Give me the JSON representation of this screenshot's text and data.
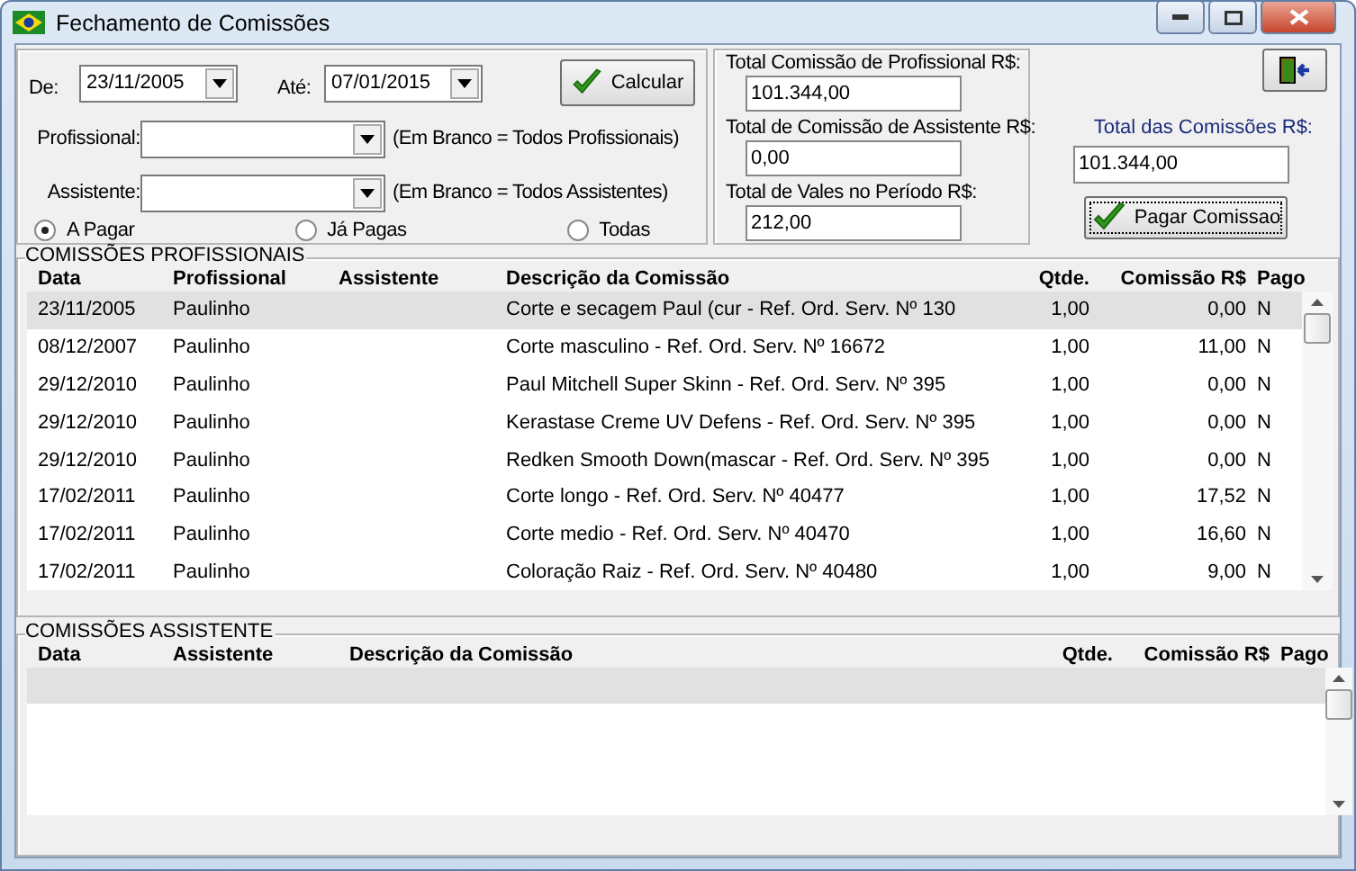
{
  "window": {
    "title": "Fechamento de Comissões"
  },
  "filters": {
    "from_label": "De:",
    "from_date": "23/11/2005",
    "to_label": "Até:",
    "to_date": "07/01/2015",
    "calculate_button": "Calcular",
    "professional_label": "Profissional:",
    "professional_hint": "(Em Branco = Todos Profissionais)",
    "assistant_label": "Assistente:",
    "assistant_hint": "(Em Branco = Todos Assistentes)",
    "status_options": [
      {
        "label": "A Pagar",
        "selected": true
      },
      {
        "label": "Já Pagas",
        "selected": false
      },
      {
        "label": "Todas",
        "selected": false
      }
    ]
  },
  "totals": [
    {
      "label": "Total Comissão de Profissional R$:",
      "value": "101.344,00"
    },
    {
      "label": "Total de Comissão de Assistente R$:",
      "value": "0,00"
    },
    {
      "label": "Total de Vales no Período R$:",
      "value": "212,00"
    }
  ],
  "grand_total": {
    "label": "Total das Comissões R$:",
    "value": "101.344,00"
  },
  "pay_button": "Pagar Comissao",
  "professional_commissions": {
    "title": "COMISSÕES PROFISSIONAIS",
    "columns": [
      "Data",
      "Profissional",
      "Assistente",
      "Descrição da Comissão",
      "Qtde.",
      "Comissão R$",
      "Pago"
    ],
    "rows": [
      {
        "data": "23/11/2005",
        "profissional": "Paulinho",
        "descricao": "Corte e secagem Paul (cur - Ref. Ord. Serv. Nº 130",
        "qtde": "1,00",
        "comissao": "0,00",
        "pago": "N",
        "selected": true
      },
      {
        "data": "08/12/2007",
        "profissional": "Paulinho",
        "descricao": "Corte masculino - Ref. Ord. Serv. Nº 16672",
        "qtde": "1,00",
        "comissao": "11,00",
        "pago": "N",
        "selected": false
      },
      {
        "data": "29/12/2010",
        "profissional": "Paulinho",
        "descricao": "Paul Mitchell Super Skinn - Ref. Ord. Serv. Nº 395",
        "qtde": "1,00",
        "comissao": "0,00",
        "pago": "N",
        "selected": false
      },
      {
        "data": "29/12/2010",
        "profissional": "Paulinho",
        "descricao": "Kerastase Creme UV Defens - Ref. Ord. Serv. Nº 395",
        "qtde": "1,00",
        "comissao": "0,00",
        "pago": "N",
        "selected": false
      },
      {
        "data": "29/12/2010",
        "profissional": "Paulinho",
        "descricao": "Redken Smooth Down(mascar - Ref. Ord. Serv. Nº 395",
        "qtde": "1,00",
        "comissao": "0,00",
        "pago": "N",
        "selected": false
      },
      {
        "data": "17/02/2011",
        "profissional": "Paulinho",
        "descricao": "Corte longo - Ref. Ord. Serv. Nº 40477",
        "qtde": "1,00",
        "comissao": "17,52",
        "pago": "N",
        "selected": false
      },
      {
        "data": "17/02/2011",
        "profissional": "Paulinho",
        "descricao": "Corte medio - Ref. Ord. Serv. Nº 40470",
        "qtde": "1,00",
        "comissao": "16,60",
        "pago": "N",
        "selected": false
      },
      {
        "data": "17/02/2011",
        "profissional": "Paulinho",
        "descricao": "Coloração Raiz - Ref. Ord. Serv. Nº 40480",
        "qtde": "1,00",
        "comissao": "9,00",
        "pago": "N",
        "selected": false
      }
    ]
  },
  "assistant_commissions": {
    "title": "COMISSÕES ASSISTENTE",
    "columns": [
      "Data",
      "Assistente",
      "Descrição da Comissão",
      "Qtde.",
      "Comissão R$",
      "Pago"
    ]
  }
}
